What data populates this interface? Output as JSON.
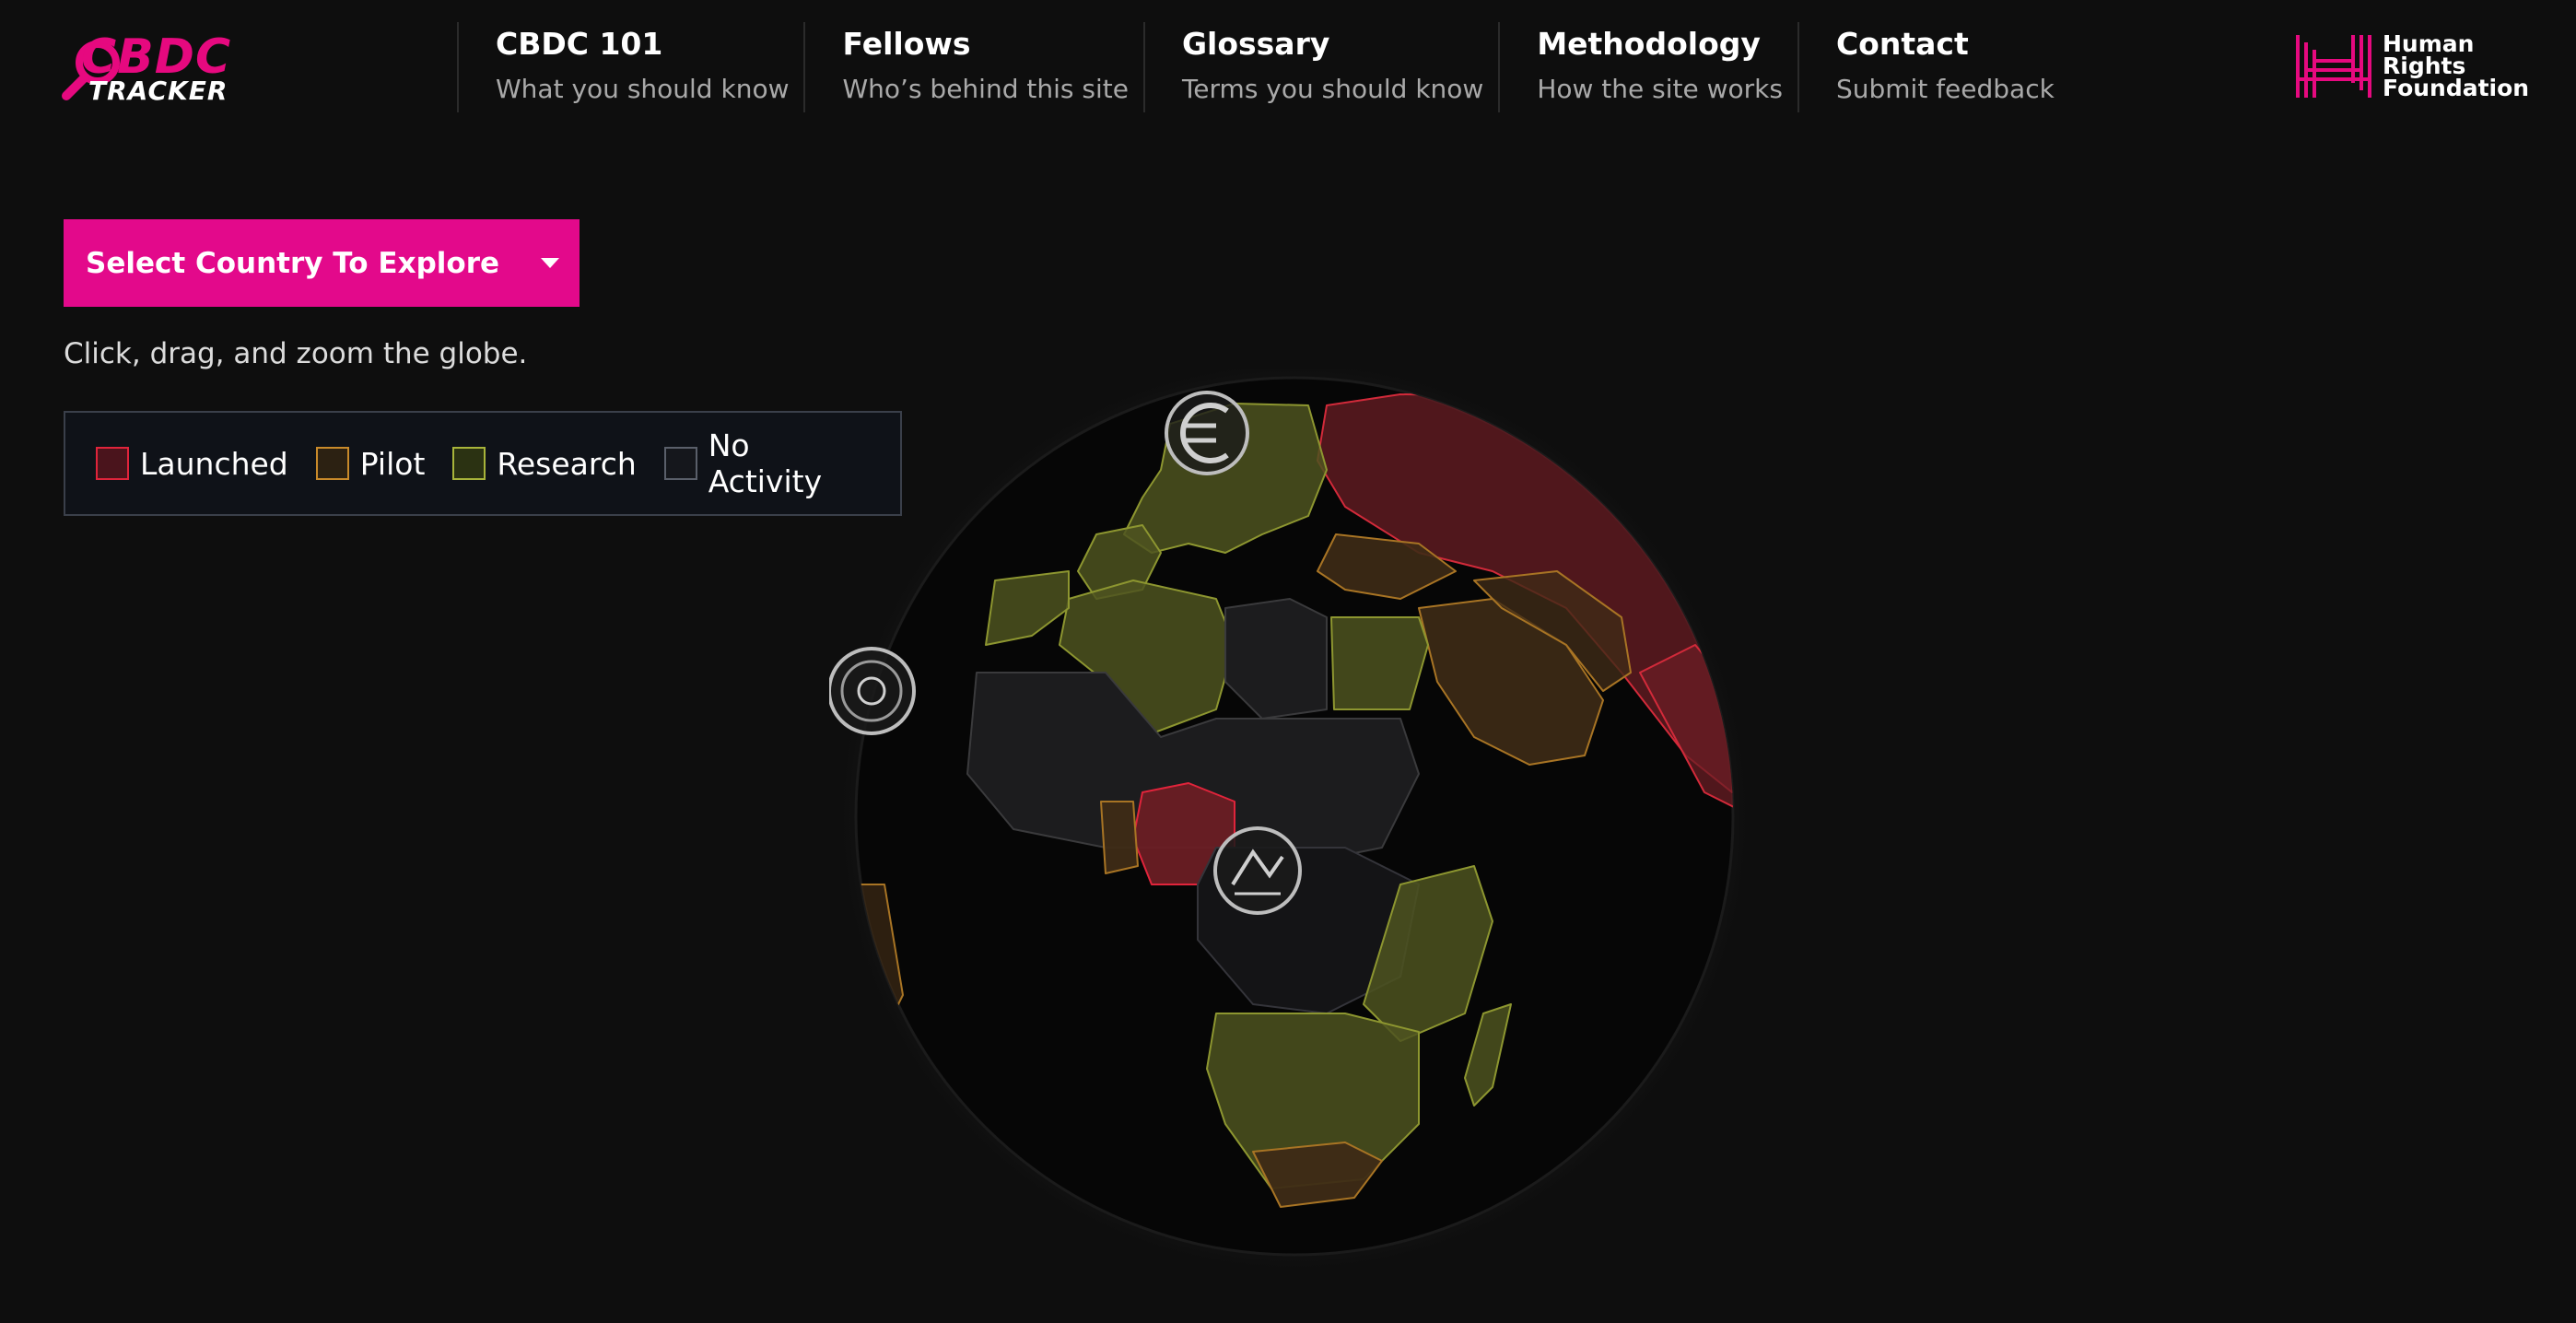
{
  "brand": {
    "logo_top": "CBDC",
    "logo_bottom": "TRACKER",
    "accent": "#e6097f"
  },
  "nav": [
    {
      "title": "CBDC 101",
      "subtitle": "What you should know"
    },
    {
      "title": "Fellows",
      "subtitle": "Who’s behind this site"
    },
    {
      "title": "Glossary",
      "subtitle": "Terms you should know"
    },
    {
      "title": "Methodology",
      "subtitle": "How the site works"
    },
    {
      "title": "Contact",
      "subtitle": "Submit feedback"
    }
  ],
  "partner": {
    "line1": "Human",
    "line2": "Rights",
    "line3": "Foundation",
    "icon": "hrf-logo-icon"
  },
  "country_select": {
    "label": "Select Country To Explore",
    "icon": "chevron-down-icon"
  },
  "instructions": "Click, drag, and zoom the globe.",
  "legend": [
    {
      "label": "Launched",
      "border": "#e0243b",
      "fill": "#4a141c"
    },
    {
      "label": "Pilot",
      "border": "#c98a2a",
      "fill": "#2c2112"
    },
    {
      "label": "Research",
      "border": "#a8b43a",
      "fill": "#2b3212"
    },
    {
      "label": "No Activity",
      "border": "#5a5f6a",
      "fill": "#15171c"
    }
  ],
  "globe": {
    "markers": [
      "euro-sign-icon",
      "central-bank-seal-icon",
      "regional-bank-seal-icon"
    ],
    "colors": {
      "launched": "#6a1e24",
      "pilot": "#3e2b16",
      "research": "#4d5420",
      "none": "#1c1c1e"
    }
  }
}
